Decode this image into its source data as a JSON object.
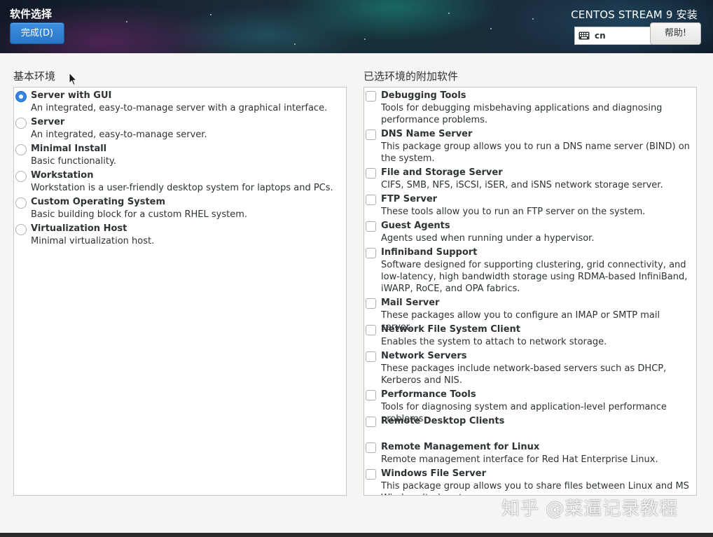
{
  "header": {
    "title": "软件选择",
    "done_label": "完成(D)",
    "product": "CENTOS STREAM 9 安装",
    "keyboard_layout": "cn",
    "help_label": "帮助!"
  },
  "base_env": {
    "heading": "基本环境",
    "selected_index": 0,
    "items": [
      {
        "name": "Server with GUI",
        "desc": "An integrated, easy-to-manage server with a graphical interface."
      },
      {
        "name": "Server",
        "desc": "An integrated, easy-to-manage server."
      },
      {
        "name": "Minimal Install",
        "desc": "Basic functionality."
      },
      {
        "name": "Workstation",
        "desc": "Workstation is a user-friendly desktop system for laptops and PCs."
      },
      {
        "name": "Custom Operating System",
        "desc": "Basic building block for a custom RHEL system."
      },
      {
        "name": "Virtualization Host",
        "desc": "Minimal virtualization host."
      }
    ]
  },
  "addons": {
    "heading": "已选环境的附加软件",
    "items": [
      {
        "name": "Debugging Tools",
        "desc": "Tools for debugging misbehaving applications and diagnosing performance problems."
      },
      {
        "name": "DNS Name Server",
        "desc": "This package group allows you to run a DNS name server (BIND) on the system."
      },
      {
        "name": "File and Storage Server",
        "desc": "CIFS, SMB, NFS, iSCSI, iSER, and iSNS network storage server."
      },
      {
        "name": "FTP Server",
        "desc": "These tools allow you to run an FTP server on the system."
      },
      {
        "name": "Guest Agents",
        "desc": "Agents used when running under a hypervisor."
      },
      {
        "name": "Infiniband Support",
        "desc": "Software designed for supporting clustering, grid connectivity, and low-latency, high bandwidth storage using RDMA-based InfiniBand, iWARP, RoCE, and OPA fabrics."
      },
      {
        "name": "Mail Server",
        "desc": "These packages allow you to configure an IMAP or SMTP mail server."
      },
      {
        "name": "Network File System Client",
        "desc": "Enables the system to attach to network storage."
      },
      {
        "name": "Network Servers",
        "desc": "These packages include network-based servers such as DHCP, Kerberos and NIS."
      },
      {
        "name": "Performance Tools",
        "desc": "Tools for diagnosing system and application-level performance problems."
      },
      {
        "name": "Remote Desktop Clients",
        "desc": ""
      },
      {
        "name": "Remote Management for Linux",
        "desc": "Remote management interface for Red Hat Enterprise Linux."
      },
      {
        "name": "Windows File Server",
        "desc": "This package group allows you to share files between Linux and MS Windows(tm) systems."
      }
    ]
  },
  "watermark": "知乎 @菜逼记录教程",
  "colors": {
    "accent": "#3584e4",
    "done_button": "#2a76c6"
  }
}
